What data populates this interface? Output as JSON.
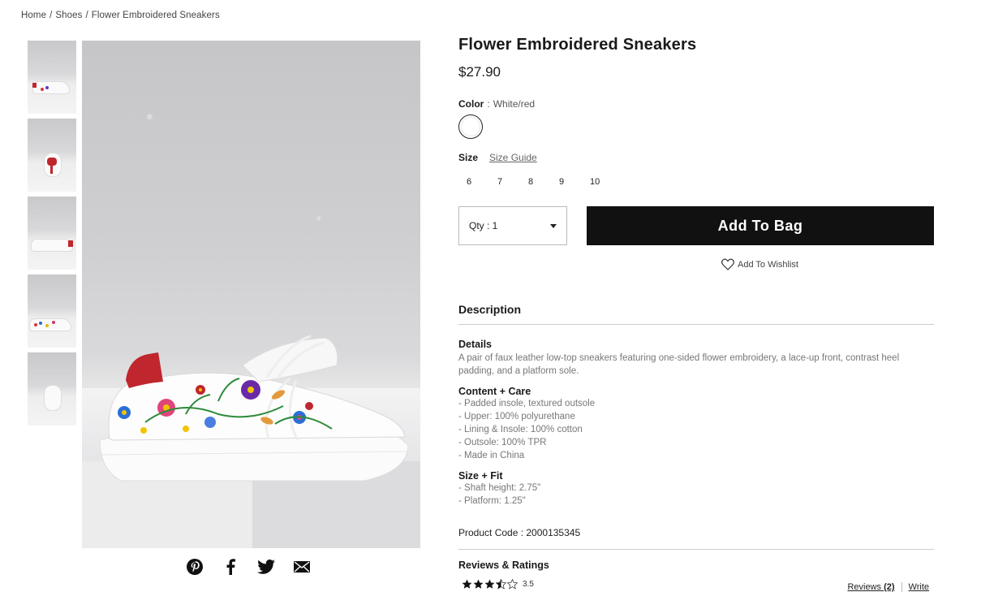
{
  "breadcrumb": {
    "home": "Home",
    "category": "Shoes",
    "current": "Flower Embroidered Sneakers",
    "separator": "/"
  },
  "product": {
    "title": "Flower Embroidered Sneakers",
    "price": "$27.90",
    "color_label": "Color",
    "color_sep": ":",
    "color_value": "White/red",
    "size_label": "Size",
    "size_guide": "Size Guide",
    "sizes": [
      "6",
      "7",
      "8",
      "9",
      "10"
    ],
    "qty_label": "Qty : 1",
    "add_to_bag": "Add To Bag",
    "wishlist": "Add To Wishlist"
  },
  "description": {
    "heading": "Description",
    "details_title": "Details",
    "details_text": "A pair of faux leather low-top sneakers featuring one-sided flower embroidery, a lace-up front, contrast heel padding, and a platform sole.",
    "care_title": "Content + Care",
    "care_items": [
      "- Padded insole, textured outsole",
      "- Upper: 100% polyurethane",
      "- Lining & Insole: 100% cotton",
      "- Outsole: 100% TPR",
      "- Made in China"
    ],
    "fit_title": "Size + Fit",
    "fit_items": [
      "- Shaft height: 2.75\"",
      "- Platform: 1.25\""
    ],
    "product_code": "Product Code : 2000135345"
  },
  "reviews": {
    "heading": "Reviews & Ratings",
    "rating": "3.5",
    "rating_value": 3.5,
    "link_label": "Reviews",
    "count": "(2)",
    "write": "Write"
  },
  "share": {
    "icons": [
      "pinterest-icon",
      "facebook-icon",
      "twitter-icon",
      "email-icon"
    ]
  },
  "colors": {
    "accent_black": "#111111",
    "heel_red": "#c0262d",
    "text_muted": "#777777"
  }
}
